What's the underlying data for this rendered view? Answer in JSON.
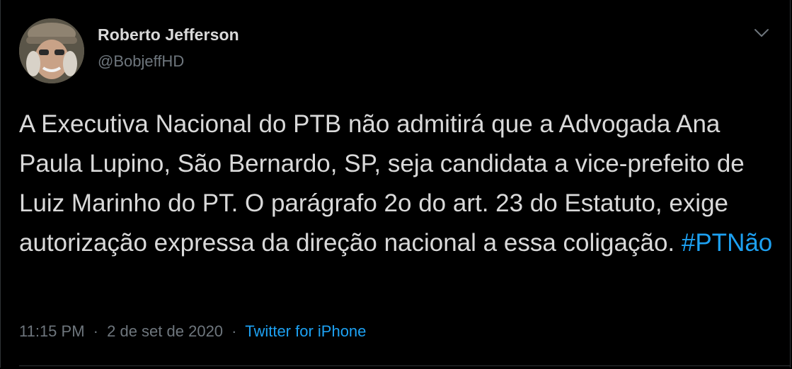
{
  "author": {
    "name": "Roberto Jefferson",
    "handle": "@BobjeffHD"
  },
  "tweet": {
    "text": "A Executiva Nacional do PTB não admitirá que a Advogada Ana Paula Lupino, São Bernardo, SP, seja candidata a vice-prefeito de Luiz Marinho do PT. O parágrafo 2o do art. 23 do Estatuto, exige autorização expressa da direção nacional a essa coligação.",
    "hashtag": "#PTNão"
  },
  "meta": {
    "time": "11:15 PM",
    "separator": "·",
    "date": "2 de set de 2020",
    "source": "Twitter for iPhone"
  },
  "icons": {
    "menu": "chevron-down-icon"
  },
  "colors": {
    "background": "#000000",
    "text": "#d9d9d9",
    "secondary": "#6e767d",
    "accent": "#1da1f2"
  }
}
